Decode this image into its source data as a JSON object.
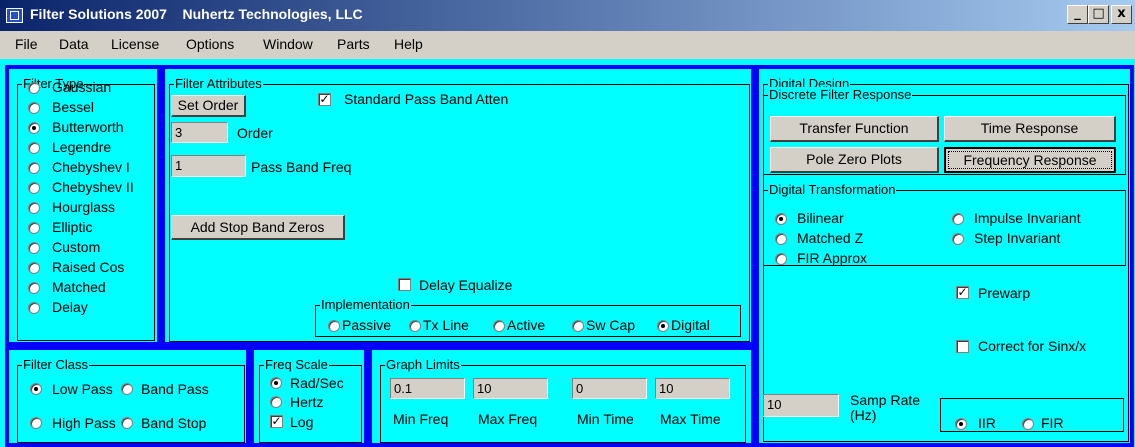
{
  "title": "Filter Solutions 2007    Nuhertz Technologies, LLC",
  "window_buttons": {
    "minimize": "_",
    "maximize": "□",
    "close": "x"
  },
  "menu": [
    "File",
    "Data",
    "License",
    "Options",
    "Window",
    "Parts",
    "Help"
  ],
  "filter_type": {
    "label": "Filter Type",
    "options": [
      "Gaussian",
      "Bessel",
      "Butterworth",
      "Legendre",
      "Chebyshev I",
      "Chebyshev II",
      "Hourglass",
      "Elliptic",
      "Custom",
      "Raised Cos",
      "Matched",
      "Delay"
    ],
    "selected": "Butterworth"
  },
  "filter_attributes": {
    "label": "Filter Attributes",
    "set_order_button": "Set Order",
    "order_value": "3",
    "order_label": "Order",
    "pass_band_freq_value": "1",
    "pass_band_freq_label": "Pass Band Freq",
    "standard_atten_label": "Standard Pass Band Atten",
    "standard_atten_checked": true,
    "add_stop_band_zeros_button": "Add Stop Band Zeros",
    "delay_equalize_label": "Delay Equalize",
    "delay_equalize_checked": false
  },
  "implementation": {
    "label": "Implementation",
    "options": [
      "Passive",
      "Tx Line",
      "Active",
      "Sw Cap",
      "Digital"
    ],
    "selected": "Digital"
  },
  "filter_class": {
    "label": "Filter Class",
    "options": [
      "Low Pass",
      "Band Pass",
      "High Pass",
      "Band Stop"
    ],
    "selected": "Low Pass"
  },
  "freq_scale": {
    "label": "Freq Scale",
    "options": [
      "Rad/Sec",
      "Hertz"
    ],
    "selected": "Rad/Sec",
    "log_label": "Log",
    "log_checked": true
  },
  "graph_limits": {
    "label": "Graph Limits",
    "min_freq_value": "0.1",
    "max_freq_value": "10",
    "min_time_value": "0",
    "max_time_value": "10",
    "min_freq_label": "Min Freq",
    "max_freq_label": "Max Freq",
    "min_time_label": "Min Time",
    "max_time_label": "Max Time"
  },
  "digital_design": {
    "label": "Digital Design",
    "discrete_response_label": "Discrete Filter Response",
    "transfer_function_button": "Transfer Function",
    "time_response_button": "Time Response",
    "pole_zero_button": "Pole Zero Plots",
    "frequency_response_button": "Frequency Response",
    "transformation_label": "Digital Transformation",
    "transformations": [
      "Bilinear",
      "Impulse Invariant",
      "Matched Z",
      "Step Invariant",
      "FIR Approx"
    ],
    "transformation_selected": "Bilinear",
    "prewarp_label": "Prewarp",
    "prewarp_checked": true,
    "sinx_label": "Correct for Sinx/x",
    "sinx_checked": false,
    "samp_rate_value": "10",
    "samp_rate_label_1": "Samp Rate",
    "samp_rate_label_2": "(Hz)",
    "iir_label": "IIR",
    "fir_label": "FIR",
    "iir_fir_selected": "IIR"
  }
}
